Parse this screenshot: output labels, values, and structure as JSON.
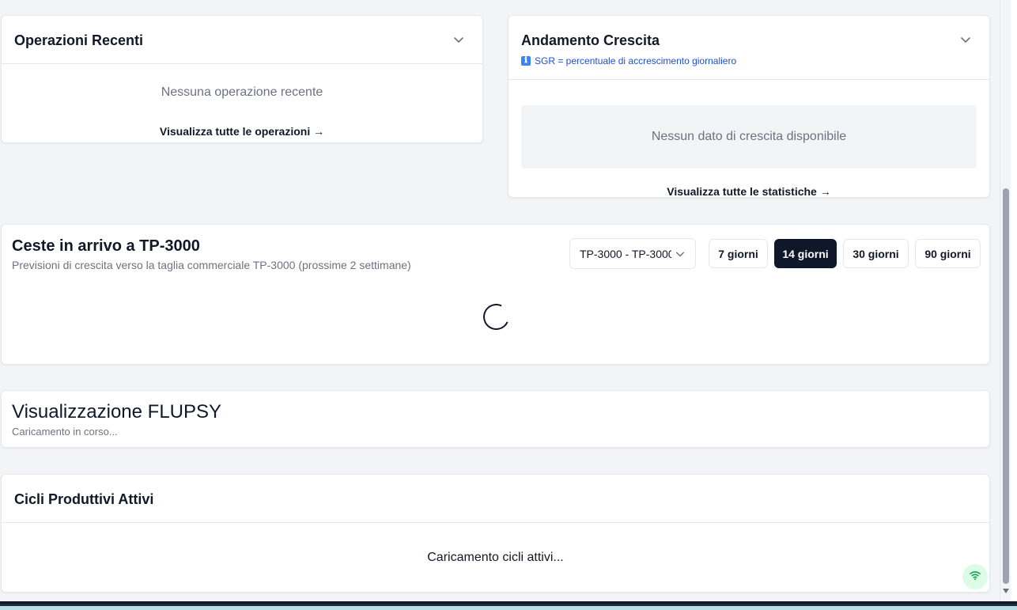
{
  "recent_operations": {
    "title": "Operazioni Recenti",
    "empty_text": "Nessuna operazione recente",
    "link": "Visualizza tutte le operazioni →"
  },
  "growth": {
    "title": "Andamento Crescita",
    "info_icon": "ℹ",
    "info_text": "SGR = percentuale di accrescimento giornaliero",
    "empty_text": "Nessun dato di crescita disponibile",
    "link": "Visualizza tutte le statistiche →"
  },
  "baskets": {
    "title": "Ceste in arrivo a TP-3000",
    "subtitle": "Previsioni di crescita verso la taglia commerciale TP-3000 (prossime 2 settimane)",
    "size_select_value": "TP-3000 - TP-3000",
    "ranges": [
      "7 giorni",
      "14 giorni",
      "30 giorni",
      "90 giorni"
    ],
    "active_range": "14 giorni"
  },
  "flupsy": {
    "title": "Visualizzazione FLUPSY",
    "subtitle": "Caricamento in corso..."
  },
  "cycles": {
    "title": "Cicli Produttivi Attivi",
    "loading_text": "Caricamento cicli attivi..."
  },
  "colors": {
    "accent_dark": "#0f172a",
    "info_blue": "#1d4ed8",
    "connection_ok": "#16a34a"
  }
}
